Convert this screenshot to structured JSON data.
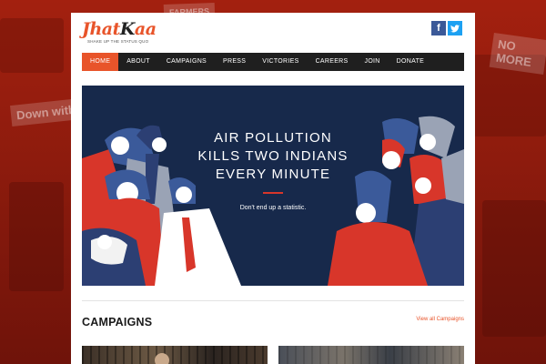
{
  "brand": {
    "logo_text_a": "Jhat",
    "logo_text_b": "K",
    "logo_text_c": "aa",
    "tagline": "SHAKE UP THE STATUS QUO",
    "accent_color": "#e8542a"
  },
  "background": {
    "signs": [
      "NO MORE",
      "Down with",
      "FARMERS"
    ]
  },
  "social": {
    "facebook_glyph": "f",
    "twitter_glyph": "t"
  },
  "nav": {
    "items": [
      "HOME",
      "ABOUT",
      "CAMPAIGNS",
      "PRESS",
      "VICTORIES",
      "CAREERS",
      "JOIN",
      "DONATE"
    ],
    "active": "HOME"
  },
  "banner": {
    "line1": "AIR POLLUTION",
    "line2": "KILLS TWO INDIANS",
    "line3": "EVERY MINUTE",
    "subtext": "Don't end up a statistic.",
    "background_color": "#17294b"
  },
  "campaigns": {
    "title": "CAMPAIGNS",
    "view_all": "View all Campaigns"
  }
}
